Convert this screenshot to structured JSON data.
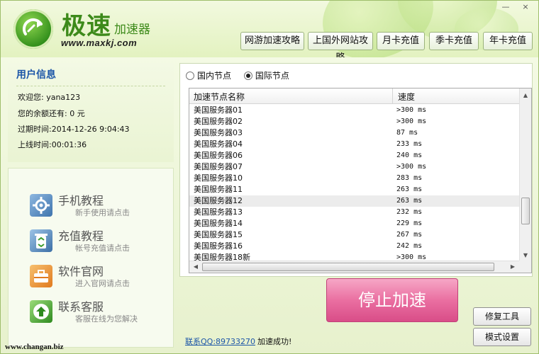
{
  "app": {
    "brand_main": "极速",
    "brand_sub": "加速器",
    "url": "www.maxkj.com"
  },
  "window_controls": {
    "minimize": "—",
    "close": "×"
  },
  "top_buttons": [
    "网游加速攻略",
    "上国外网站攻略",
    "月卡充值",
    "季卡充值",
    "年卡充值"
  ],
  "user": {
    "title": "用户信息",
    "welcome": "欢迎您: yana123",
    "balance": "您的余额还有: 0 元",
    "expire": "过期时间:2014-12-26 9:04:43",
    "online": "上线时间:00:01:36"
  },
  "menu": [
    {
      "title": "手机教程",
      "sub": "新手使用请点击",
      "icon": "gear-icon",
      "color": "#4a7fb8"
    },
    {
      "title": "充值教程",
      "sub": "帐号充值请点击",
      "icon": "recycle-bin-icon",
      "color": "#3c78b0"
    },
    {
      "title": "软件官网",
      "sub": "进入官网请点击",
      "icon": "toolbox-icon",
      "color": "#e8892b"
    },
    {
      "title": "联系客服",
      "sub": "客服在线为您解决",
      "icon": "up-arrow-icon",
      "color": "#3a9a2a"
    }
  ],
  "nodes": {
    "radio_domestic": "国内节点",
    "radio_international": "国际节点",
    "selected": "国际节点",
    "col_name": "加速节点名称",
    "col_speed": "速度",
    "rows": [
      {
        "name": "美国服务器01",
        "speed": ">300 ms"
      },
      {
        "name": "美国服务器02",
        "speed": ">300 ms"
      },
      {
        "name": "美国服务器03",
        "speed": " 87 ms"
      },
      {
        "name": "美国服务器04",
        "speed": "233 ms"
      },
      {
        "name": "美国服务器06",
        "speed": "240 ms"
      },
      {
        "name": "美国服务器07",
        "speed": ">300 ms"
      },
      {
        "name": "美国服务器10",
        "speed": "283 ms"
      },
      {
        "name": "美国服务器11",
        "speed": "263 ms"
      },
      {
        "name": "美国服务器12",
        "speed": "263 ms"
      },
      {
        "name": "美国服务器13",
        "speed": "232 ms"
      },
      {
        "name": "美国服务器14",
        "speed": "229 ms"
      },
      {
        "name": "美国服务器15",
        "speed": "267 ms"
      },
      {
        "name": "美国服务器16",
        "speed": "242 ms"
      },
      {
        "name": "美国服务器18新",
        "speed": ">300 ms"
      }
    ],
    "selected_row": 8
  },
  "actions": {
    "stop": "停止加速",
    "repair": "修复工具",
    "mode": "模式设置"
  },
  "status": {
    "qq": "联系QQ:89733270",
    "message": "加速成功!"
  },
  "watermark": "www.changan.biz"
}
